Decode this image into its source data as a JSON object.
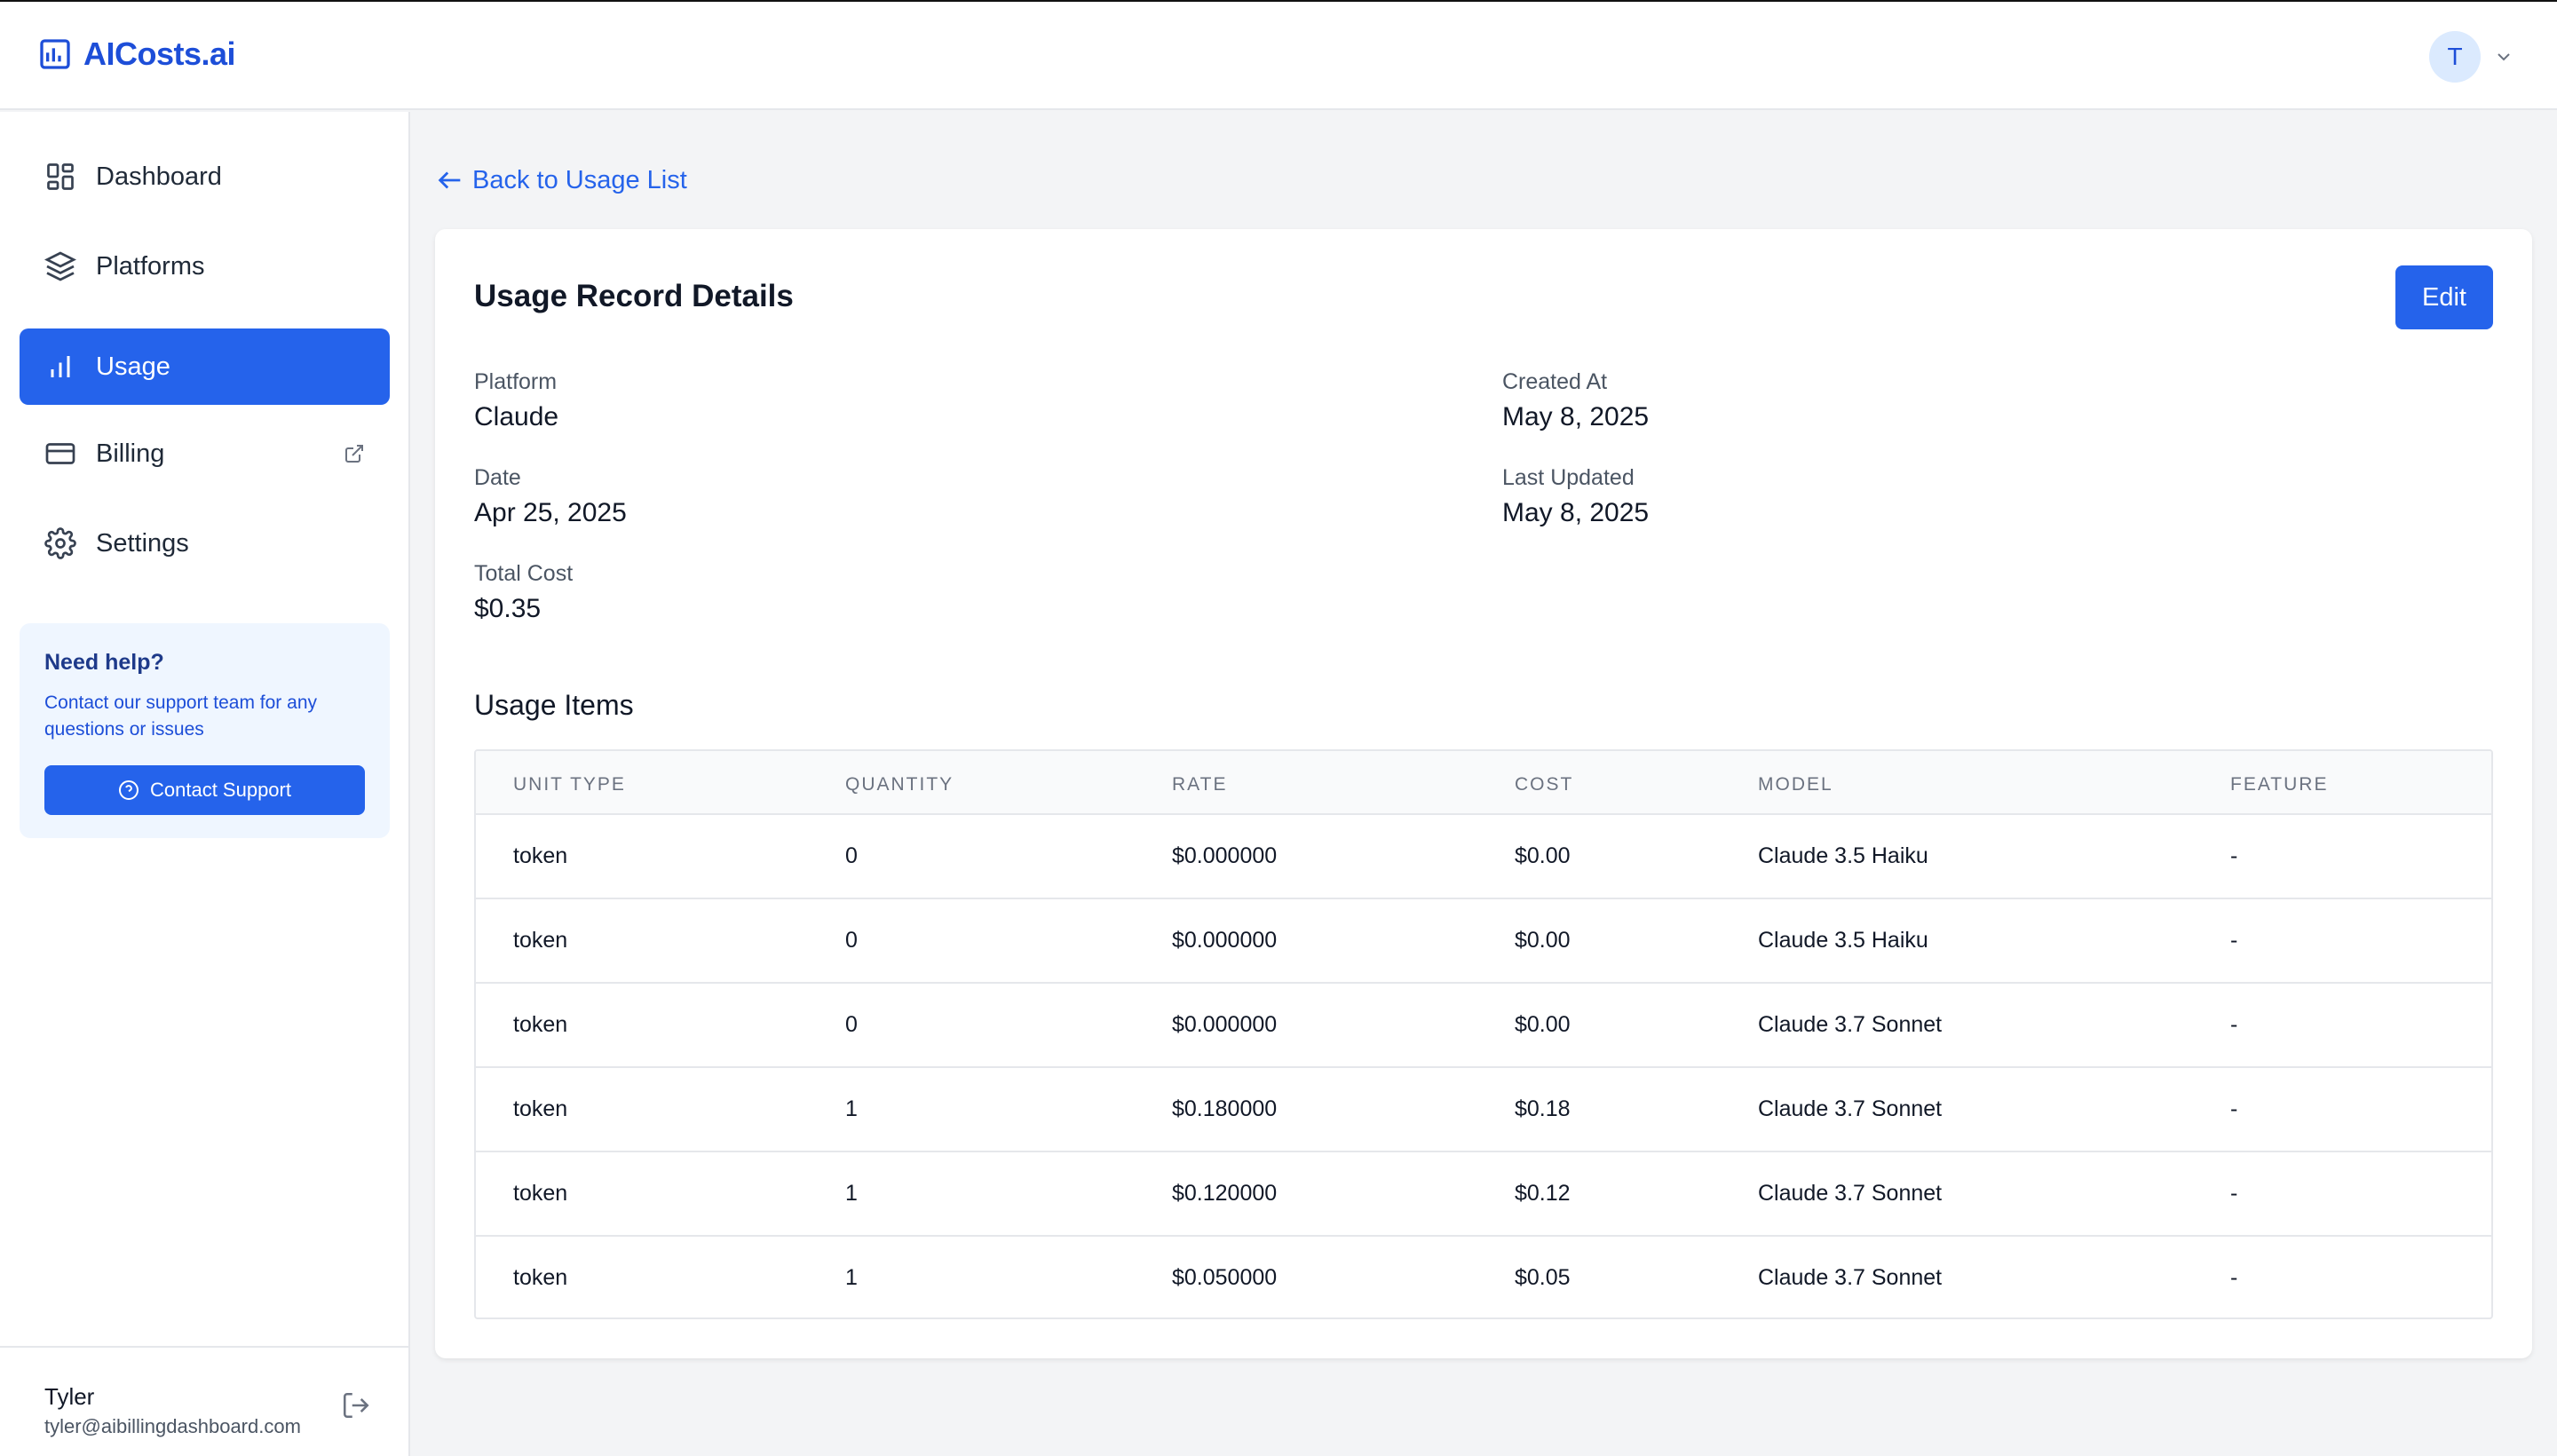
{
  "app": {
    "name": "AICosts.ai",
    "brand_color": "#2563eb"
  },
  "header": {
    "avatar_initial": "T"
  },
  "sidebar": {
    "items": [
      {
        "label": "Dashboard",
        "icon": "dashboard-grid-icon",
        "active": false
      },
      {
        "label": "Platforms",
        "icon": "layers-icon",
        "active": false
      },
      {
        "label": "Usage",
        "icon": "bar-chart-icon",
        "active": true
      },
      {
        "label": "Billing",
        "icon": "credit-card-icon",
        "active": false,
        "external": true
      },
      {
        "label": "Settings",
        "icon": "gear-icon",
        "active": false
      }
    ],
    "help": {
      "title": "Need help?",
      "text": "Contact our support team for any questions or issues",
      "button": "Contact Support"
    },
    "user": {
      "name": "Tyler",
      "email": "tyler@aibillingdashboard.com"
    }
  },
  "main": {
    "back_link": "Back to Usage List",
    "title": "Usage Record Details",
    "edit_label": "Edit",
    "fields": {
      "platform": {
        "label": "Platform",
        "value": "Claude"
      },
      "date": {
        "label": "Date",
        "value": "Apr 25, 2025"
      },
      "total_cost": {
        "label": "Total Cost",
        "value": "$0.35"
      },
      "created_at": {
        "label": "Created At",
        "value": "May 8, 2025"
      },
      "last_updated": {
        "label": "Last Updated",
        "value": "May 8, 2025"
      }
    },
    "usage_items": {
      "title": "Usage Items",
      "columns": [
        "UNIT TYPE",
        "QUANTITY",
        "RATE",
        "COST",
        "MODEL",
        "FEATURE"
      ],
      "rows": [
        [
          "token",
          "0",
          "$0.000000",
          "$0.00",
          "Claude 3.5 Haiku",
          "-"
        ],
        [
          "token",
          "0",
          "$0.000000",
          "$0.00",
          "Claude 3.5 Haiku",
          "-"
        ],
        [
          "token",
          "0",
          "$0.000000",
          "$0.00",
          "Claude 3.7 Sonnet",
          "-"
        ],
        [
          "token",
          "1",
          "$0.180000",
          "$0.18",
          "Claude 3.7 Sonnet",
          "-"
        ],
        [
          "token",
          "1",
          "$0.120000",
          "$0.12",
          "Claude 3.7 Sonnet",
          "-"
        ],
        [
          "token",
          "1",
          "$0.050000",
          "$0.05",
          "Claude 3.7 Sonnet",
          "-"
        ]
      ]
    }
  }
}
